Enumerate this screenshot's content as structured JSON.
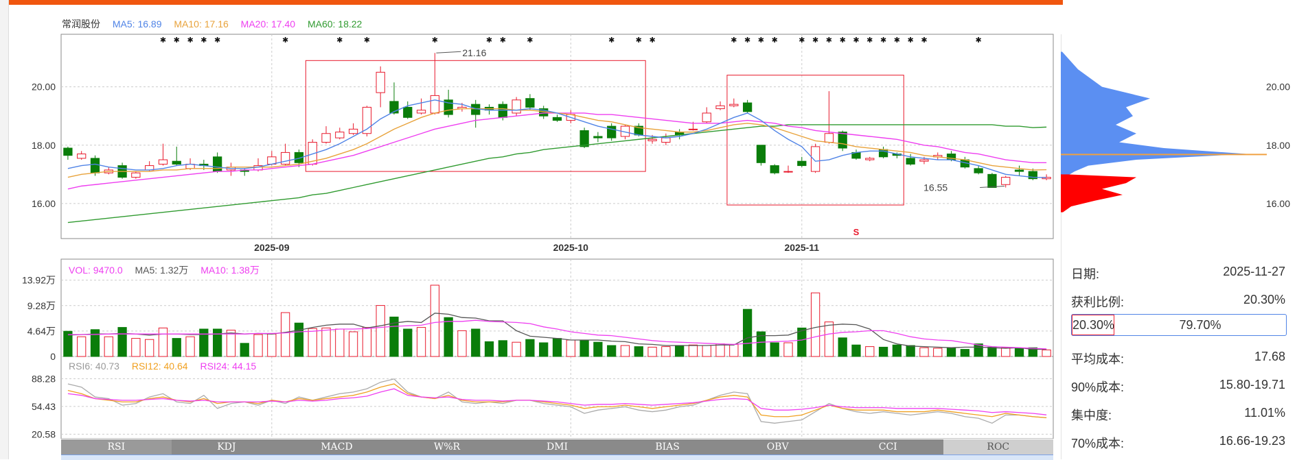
{
  "chart_data": {
    "type": "candlestick",
    "stock_name": "常润股份",
    "ma_legend": [
      {
        "label": "MA5: 16.89",
        "color": "#4f83e6"
      },
      {
        "label": "MA10: 17.16",
        "color": "#e8a23a"
      },
      {
        "label": "MA20: 17.40",
        "color": "#ee3ef0"
      },
      {
        "label": "MA60: 18.22",
        "color": "#2f9a2f"
      }
    ],
    "price_ticks": [
      "20.00",
      "18.00",
      "16.00"
    ],
    "price_ticks_values": [
      20,
      18,
      16
    ],
    "x_ticks": [
      {
        "label": "2025-09",
        "index": 15
      },
      {
        "label": "2025-10",
        "index": 37
      },
      {
        "label": "2025-11",
        "index": 54
      }
    ],
    "annotations": [
      {
        "text": "21.16",
        "index": 27,
        "price": 21.16
      },
      {
        "text": "16.55",
        "index": 67,
        "price": 16.55
      }
    ],
    "boxes": [
      {
        "from": 18,
        "to": 42,
        "low": 17.1,
        "high": 20.9
      },
      {
        "from": 49,
        "to": 61,
        "low": 15.95,
        "high": 20.4
      }
    ],
    "signal": "S",
    "candles": [
      [
        17.9,
        17.65,
        17.95,
        17.5
      ],
      [
        17.55,
        17.7,
        17.8,
        17.5
      ],
      [
        17.55,
        17.05,
        17.65,
        16.95
      ],
      [
        17.05,
        17.15,
        17.25,
        17.0
      ],
      [
        17.3,
        16.9,
        17.4,
        16.85
      ],
      [
        16.9,
        17.05,
        17.1,
        16.85
      ],
      [
        17.15,
        17.3,
        17.45,
        17.1
      ],
      [
        17.35,
        17.5,
        18.05,
        17.3
      ],
      [
        17.45,
        17.35,
        17.95,
        17.3
      ],
      [
        17.2,
        17.35,
        17.55,
        17.15
      ],
      [
        17.35,
        17.3,
        17.5,
        17.15
      ],
      [
        17.6,
        17.1,
        17.75,
        17.05
      ],
      [
        17.15,
        17.25,
        17.4,
        16.95
      ],
      [
        17.15,
        17.1,
        17.2,
        16.95
      ],
      [
        17.15,
        17.3,
        17.55,
        17.1
      ],
      [
        17.35,
        17.6,
        17.8,
        17.3
      ],
      [
        17.35,
        17.75,
        18.05,
        17.3
      ],
      [
        17.75,
        17.4,
        17.85,
        17.25
      ],
      [
        17.35,
        18.1,
        18.2,
        17.3
      ],
      [
        18.1,
        18.4,
        18.65,
        18.05
      ],
      [
        18.25,
        18.45,
        18.6,
        18.2
      ],
      [
        18.4,
        18.55,
        18.75,
        18.35
      ],
      [
        18.4,
        19.3,
        19.35,
        18.3
      ],
      [
        19.8,
        20.5,
        20.7,
        19.3
      ],
      [
        19.5,
        19.1,
        20.15,
        19.05
      ],
      [
        19.3,
        18.95,
        19.5,
        18.9
      ],
      [
        19.1,
        19.2,
        19.6,
        19.05
      ],
      [
        19.1,
        19.7,
        21.16,
        19.05
      ],
      [
        19.55,
        19.05,
        19.9,
        18.95
      ],
      [
        19.25,
        19.3,
        19.45,
        19.15
      ],
      [
        19.4,
        19.05,
        19.55,
        18.6
      ],
      [
        19.3,
        19.2,
        19.4,
        19.05
      ],
      [
        19.4,
        18.95,
        19.5,
        18.85
      ],
      [
        19.1,
        19.55,
        19.65,
        19.0
      ],
      [
        19.6,
        19.3,
        19.75,
        19.2
      ],
      [
        19.25,
        19.0,
        19.35,
        18.9
      ],
      [
        18.95,
        18.85,
        19.05,
        18.8
      ],
      [
        18.85,
        19.05,
        19.2,
        18.75
      ],
      [
        18.5,
        17.95,
        18.6,
        17.9
      ],
      [
        18.3,
        18.25,
        18.45,
        18.1
      ],
      [
        18.65,
        18.25,
        18.75,
        18.15
      ],
      [
        18.3,
        18.65,
        18.7,
        18.2
      ],
      [
        18.65,
        18.35,
        18.75,
        18.3
      ],
      [
        18.15,
        18.2,
        18.35,
        18.05
      ],
      [
        18.1,
        18.25,
        18.4,
        18.0
      ],
      [
        18.45,
        18.35,
        18.55,
        18.2
      ],
      [
        18.55,
        18.55,
        18.8,
        18.5
      ],
      [
        18.8,
        19.1,
        19.3,
        18.75
      ],
      [
        19.25,
        19.35,
        19.5,
        19.2
      ],
      [
        19.35,
        19.4,
        19.6,
        19.3
      ],
      [
        19.45,
        19.15,
        19.55,
        19.1
      ],
      [
        18.0,
        17.4,
        18.0,
        17.3
      ],
      [
        17.3,
        17.05,
        17.35,
        17.0
      ],
      [
        17.1,
        17.1,
        17.3,
        17.05
      ],
      [
        17.45,
        17.3,
        17.6,
        17.25
      ],
      [
        17.1,
        17.95,
        18.05,
        17.05
      ],
      [
        18.1,
        18.4,
        19.85,
        18.05
      ],
      [
        18.45,
        17.9,
        18.5,
        17.8
      ],
      [
        17.75,
        17.55,
        17.85,
        17.5
      ],
      [
        17.5,
        17.55,
        17.6,
        17.45
      ],
      [
        17.85,
        17.6,
        17.95,
        17.55
      ],
      [
        17.7,
        17.65,
        17.75,
        17.55
      ],
      [
        17.55,
        17.35,
        17.7,
        17.3
      ],
      [
        17.45,
        17.5,
        17.6,
        17.35
      ],
      [
        17.6,
        17.65,
        17.75,
        17.5
      ],
      [
        17.7,
        17.5,
        17.8,
        17.45
      ],
      [
        17.5,
        17.25,
        17.6,
        17.2
      ],
      [
        17.2,
        17.05,
        17.3,
        17.0
      ],
      [
        17.0,
        16.55,
        17.05,
        16.55
      ],
      [
        16.65,
        16.9,
        16.95,
        16.55
      ],
      [
        17.15,
        17.1,
        17.3,
        16.95
      ],
      [
        17.1,
        16.85,
        17.2,
        16.8
      ],
      [
        16.85,
        16.9,
        17.0,
        16.8
      ]
    ],
    "ma5": [
      17.2,
      17.3,
      17.35,
      17.25,
      17.2,
      17.15,
      17.15,
      17.2,
      17.3,
      17.35,
      17.3,
      17.25,
      17.2,
      17.2,
      17.25,
      17.35,
      17.45,
      17.55,
      17.7,
      17.85,
      18.05,
      18.3,
      18.55,
      18.9,
      19.15,
      19.35,
      19.45,
      19.55,
      19.45,
      19.4,
      19.25,
      19.2,
      19.2,
      19.2,
      19.25,
      19.2,
      19.1,
      18.95,
      18.8,
      18.65,
      18.55,
      18.45,
      18.35,
      18.3,
      18.25,
      18.3,
      18.4,
      18.55,
      18.75,
      18.95,
      19.1,
      18.85,
      18.5,
      18.2,
      17.95,
      17.45,
      17.5,
      17.65,
      17.75,
      17.8,
      17.8,
      17.7,
      17.6,
      17.55,
      17.5,
      17.5,
      17.4,
      17.3,
      17.15,
      17.0,
      16.95,
      16.9,
      16.89
    ],
    "ma10": [
      16.9,
      17.0,
      17.05,
      17.1,
      17.1,
      17.1,
      17.1,
      17.15,
      17.15,
      17.2,
      17.2,
      17.2,
      17.25,
      17.25,
      17.25,
      17.25,
      17.3,
      17.35,
      17.45,
      17.55,
      17.7,
      17.85,
      18.05,
      18.3,
      18.55,
      18.75,
      18.95,
      19.1,
      19.2,
      19.25,
      19.25,
      19.25,
      19.25,
      19.2,
      19.2,
      19.15,
      19.1,
      19.05,
      18.95,
      18.85,
      18.8,
      18.7,
      18.6,
      18.55,
      18.5,
      18.45,
      18.45,
      18.5,
      18.6,
      18.7,
      18.75,
      18.7,
      18.6,
      18.45,
      18.3,
      18.15,
      18.1,
      18.05,
      17.95,
      17.9,
      17.85,
      17.8,
      17.75,
      17.65,
      17.6,
      17.55,
      17.5,
      17.4,
      17.3,
      17.25,
      17.2,
      17.15,
      17.16
    ],
    "ma20": [
      16.5,
      16.6,
      16.65,
      16.7,
      16.75,
      16.8,
      16.85,
      16.9,
      16.95,
      17.0,
      17.05,
      17.1,
      17.1,
      17.15,
      17.15,
      17.2,
      17.25,
      17.3,
      17.35,
      17.45,
      17.55,
      17.65,
      17.8,
      17.95,
      18.1,
      18.25,
      18.4,
      18.55,
      18.65,
      18.75,
      18.85,
      18.9,
      18.95,
      19.0,
      19.05,
      19.1,
      19.1,
      19.1,
      19.1,
      19.05,
      19.05,
      19.0,
      18.95,
      18.9,
      18.85,
      18.8,
      18.75,
      18.75,
      18.75,
      18.8,
      18.85,
      18.8,
      18.75,
      18.65,
      18.6,
      18.5,
      18.45,
      18.4,
      18.35,
      18.3,
      18.25,
      18.2,
      18.1,
      18.0,
      17.95,
      17.85,
      17.75,
      17.7,
      17.6,
      17.5,
      17.45,
      17.4,
      17.4
    ],
    "ma60": [
      15.35,
      15.4,
      15.45,
      15.5,
      15.55,
      15.6,
      15.65,
      15.7,
      15.75,
      15.8,
      15.85,
      15.9,
      15.95,
      16.0,
      16.05,
      16.1,
      16.15,
      16.2,
      16.3,
      16.35,
      16.45,
      16.55,
      16.65,
      16.75,
      16.85,
      16.95,
      17.05,
      17.15,
      17.25,
      17.35,
      17.45,
      17.55,
      17.6,
      17.7,
      17.75,
      17.85,
      17.9,
      17.95,
      18.0,
      18.05,
      18.1,
      18.15,
      18.2,
      18.25,
      18.3,
      18.35,
      18.4,
      18.45,
      18.5,
      18.55,
      18.6,
      18.65,
      18.65,
      18.7,
      18.7,
      18.7,
      18.7,
      18.7,
      18.7,
      18.7,
      18.7,
      18.7,
      18.7,
      18.7,
      18.7,
      18.7,
      18.7,
      18.7,
      18.7,
      18.65,
      18.65,
      18.6,
      18.62
    ],
    "vol_legend": [
      {
        "label": "VOL: 9470.0",
        "color": "#ee3ef0"
      },
      {
        "label": "MA5: 1.32万",
        "color": "#555555"
      },
      {
        "label": "MA10: 1.38万",
        "color": "#ee3ef0"
      }
    ],
    "vol_ticks": [
      "13.92万",
      "9.28万",
      "4.64万",
      "0"
    ],
    "vol_ticks_values": [
      13.92,
      9.28,
      4.64,
      0
    ],
    "volume": [
      4.6,
      3.6,
      4.9,
      3.6,
      5.3,
      3.3,
      3.1,
      5.2,
      3.3,
      3.6,
      5.0,
      5.0,
      4.8,
      2.4,
      4.0,
      4.1,
      8.0,
      6.1,
      5.1,
      5.2,
      5.0,
      4.5,
      5.3,
      9.3,
      7.2,
      5.0,
      5.3,
      13.0,
      7.1,
      4.7,
      5.0,
      2.7,
      2.9,
      2.6,
      3.1,
      2.5,
      3.3,
      3.0,
      3.0,
      2.6,
      2.0,
      2.0,
      1.8,
      1.7,
      1.8,
      1.9,
      2.1,
      2.0,
      2.3,
      2.2,
      8.6,
      4.5,
      2.5,
      2.5,
      5.2,
      11.6,
      6.3,
      3.4,
      2.1,
      1.8,
      1.7,
      2.1,
      2.0,
      1.6,
      1.5,
      1.6,
      1.3,
      2.3,
      1.7,
      1.6,
      1.5,
      1.6,
      1.2
    ],
    "vol_ma5": [
      3.9,
      4.0,
      4.1,
      4.1,
      4.2,
      4.1,
      3.9,
      4.1,
      4.1,
      4.0,
      4.0,
      4.1,
      4.3,
      4.1,
      4.2,
      4.1,
      4.4,
      4.8,
      5.3,
      5.7,
      5.9,
      5.9,
      5.2,
      5.6,
      6.1,
      6.4,
      6.2,
      7.9,
      7.7,
      7.1,
      7.0,
      6.5,
      6.5,
      4.7,
      3.7,
      3.5,
      3.3,
      3.0,
      3.0,
      3.0,
      2.8,
      2.7,
      2.3,
      2.2,
      2.0,
      2.0,
      2.0,
      2.0,
      2.1,
      2.1,
      3.4,
      3.8,
      3.8,
      3.9,
      4.7,
      5.3,
      5.7,
      5.9,
      5.8,
      5.0,
      3.1,
      2.3,
      1.9,
      1.8,
      1.7,
      1.6,
      1.7,
      1.7,
      1.6,
      1.5,
      1.6,
      1.3,
      1.32
    ],
    "vol_ma10": [
      4.0,
      4.0,
      4.0,
      4.1,
      4.1,
      4.1,
      4.1,
      4.1,
      4.1,
      4.1,
      4.1,
      4.1,
      4.1,
      4.1,
      4.2,
      4.2,
      4.3,
      4.5,
      4.6,
      4.8,
      5.0,
      5.0,
      5.1,
      5.3,
      5.5,
      5.6,
      5.7,
      6.2,
      6.4,
      6.4,
      6.6,
      6.4,
      6.3,
      6.2,
      6.0,
      5.4,
      5.0,
      4.5,
      4.2,
      3.9,
      3.8,
      3.5,
      3.2,
      2.9,
      2.7,
      2.6,
      2.5,
      2.4,
      2.3,
      2.2,
      2.4,
      2.6,
      2.7,
      2.8,
      3.0,
      3.6,
      4.1,
      4.4,
      4.5,
      4.7,
      4.7,
      4.2,
      3.6,
      3.2,
      3.0,
      2.9,
      2.5,
      2.1,
      1.8,
      1.7,
      1.6,
      1.5,
      1.38
    ],
    "rsi_legend": [
      {
        "label": "RSI6: 40.73",
        "color": "#999999"
      },
      {
        "label": "RSI12: 40.64",
        "color": "#f0a020"
      },
      {
        "label": "RSI24: 44.15",
        "color": "#ee3ef0"
      }
    ],
    "rsi_ticks": [
      "88.28",
      "54.43",
      "20.58"
    ],
    "rsi_ticks_values": [
      88.28,
      54.43,
      20.58
    ],
    "rsi6": [
      82,
      78,
      66,
      64,
      56,
      58,
      66,
      70,
      60,
      58,
      68,
      52,
      58,
      60,
      56,
      62,
      58,
      66,
      62,
      66,
      70,
      72,
      76,
      84,
      88,
      72,
      66,
      64,
      72,
      60,
      58,
      60,
      58,
      62,
      62,
      58,
      56,
      54,
      46,
      50,
      52,
      54,
      50,
      48,
      50,
      54,
      56,
      62,
      68,
      72,
      70,
      36,
      34,
      36,
      38,
      48,
      58,
      52,
      48,
      46,
      48,
      46,
      44,
      46,
      48,
      46,
      42,
      40,
      34,
      44,
      44,
      42,
      40.73
    ],
    "rsi12": [
      74,
      70,
      64,
      62,
      60,
      60,
      64,
      66,
      62,
      60,
      64,
      58,
      60,
      60,
      58,
      62,
      60,
      64,
      62,
      64,
      66,
      68,
      72,
      78,
      82,
      70,
      66,
      64,
      68,
      62,
      60,
      60,
      60,
      62,
      62,
      60,
      58,
      56,
      52,
      54,
      54,
      56,
      54,
      52,
      54,
      56,
      58,
      62,
      66,
      68,
      66,
      44,
      42,
      42,
      44,
      50,
      56,
      52,
      50,
      50,
      50,
      48,
      48,
      48,
      50,
      48,
      46,
      44,
      42,
      46,
      44,
      42,
      40.64
    ],
    "rsi24": [
      70,
      68,
      64,
      63,
      62,
      62,
      63,
      64,
      62,
      61,
      62,
      60,
      60,
      60,
      60,
      61,
      60,
      62,
      61,
      62,
      64,
      65,
      67,
      72,
      76,
      68,
      66,
      65,
      66,
      63,
      62,
      62,
      61,
      62,
      62,
      61,
      60,
      58,
      56,
      57,
      57,
      58,
      57,
      56,
      57,
      58,
      59,
      61,
      63,
      64,
      63,
      52,
      50,
      50,
      51,
      53,
      56,
      54,
      53,
      53,
      53,
      52,
      52,
      52,
      52,
      51,
      50,
      49,
      47,
      48,
      47,
      46,
      44.15
    ],
    "indicator_tabs": [
      "RSI",
      "KDJ",
      "MACD",
      "W%R",
      "DMI",
      "BIAS",
      "OBV",
      "CCI",
      "ROC"
    ],
    "active_tab": "RSI",
    "cost_profile_ticks": [
      "20.00",
      "18.00",
      "16.00"
    ],
    "cost_profile_ticks_values": [
      20,
      18,
      16
    ],
    "colors": {
      "up": "#e8192c",
      "down": "#0a7d0a",
      "box": "#e8192c",
      "profit": "#ff0000",
      "loss": "#5b8ff2",
      "avg": "#f0a040"
    }
  },
  "chip_info": {
    "date_label": "日期:",
    "date_value": "2025-11-27",
    "profit_label": "获利比例:",
    "profit_value": "20.30%",
    "bar_left": "20.30%",
    "bar_right": "79.70%",
    "avg_label": "平均成本:",
    "avg_value": "17.68",
    "c90_label": "90%成本:",
    "c90_value": "15.80-19.71",
    "conc_label": "集中度:",
    "conc_value": "11.01%",
    "c70_label": "70%成本:",
    "c70_value": "16.66-19.23"
  }
}
